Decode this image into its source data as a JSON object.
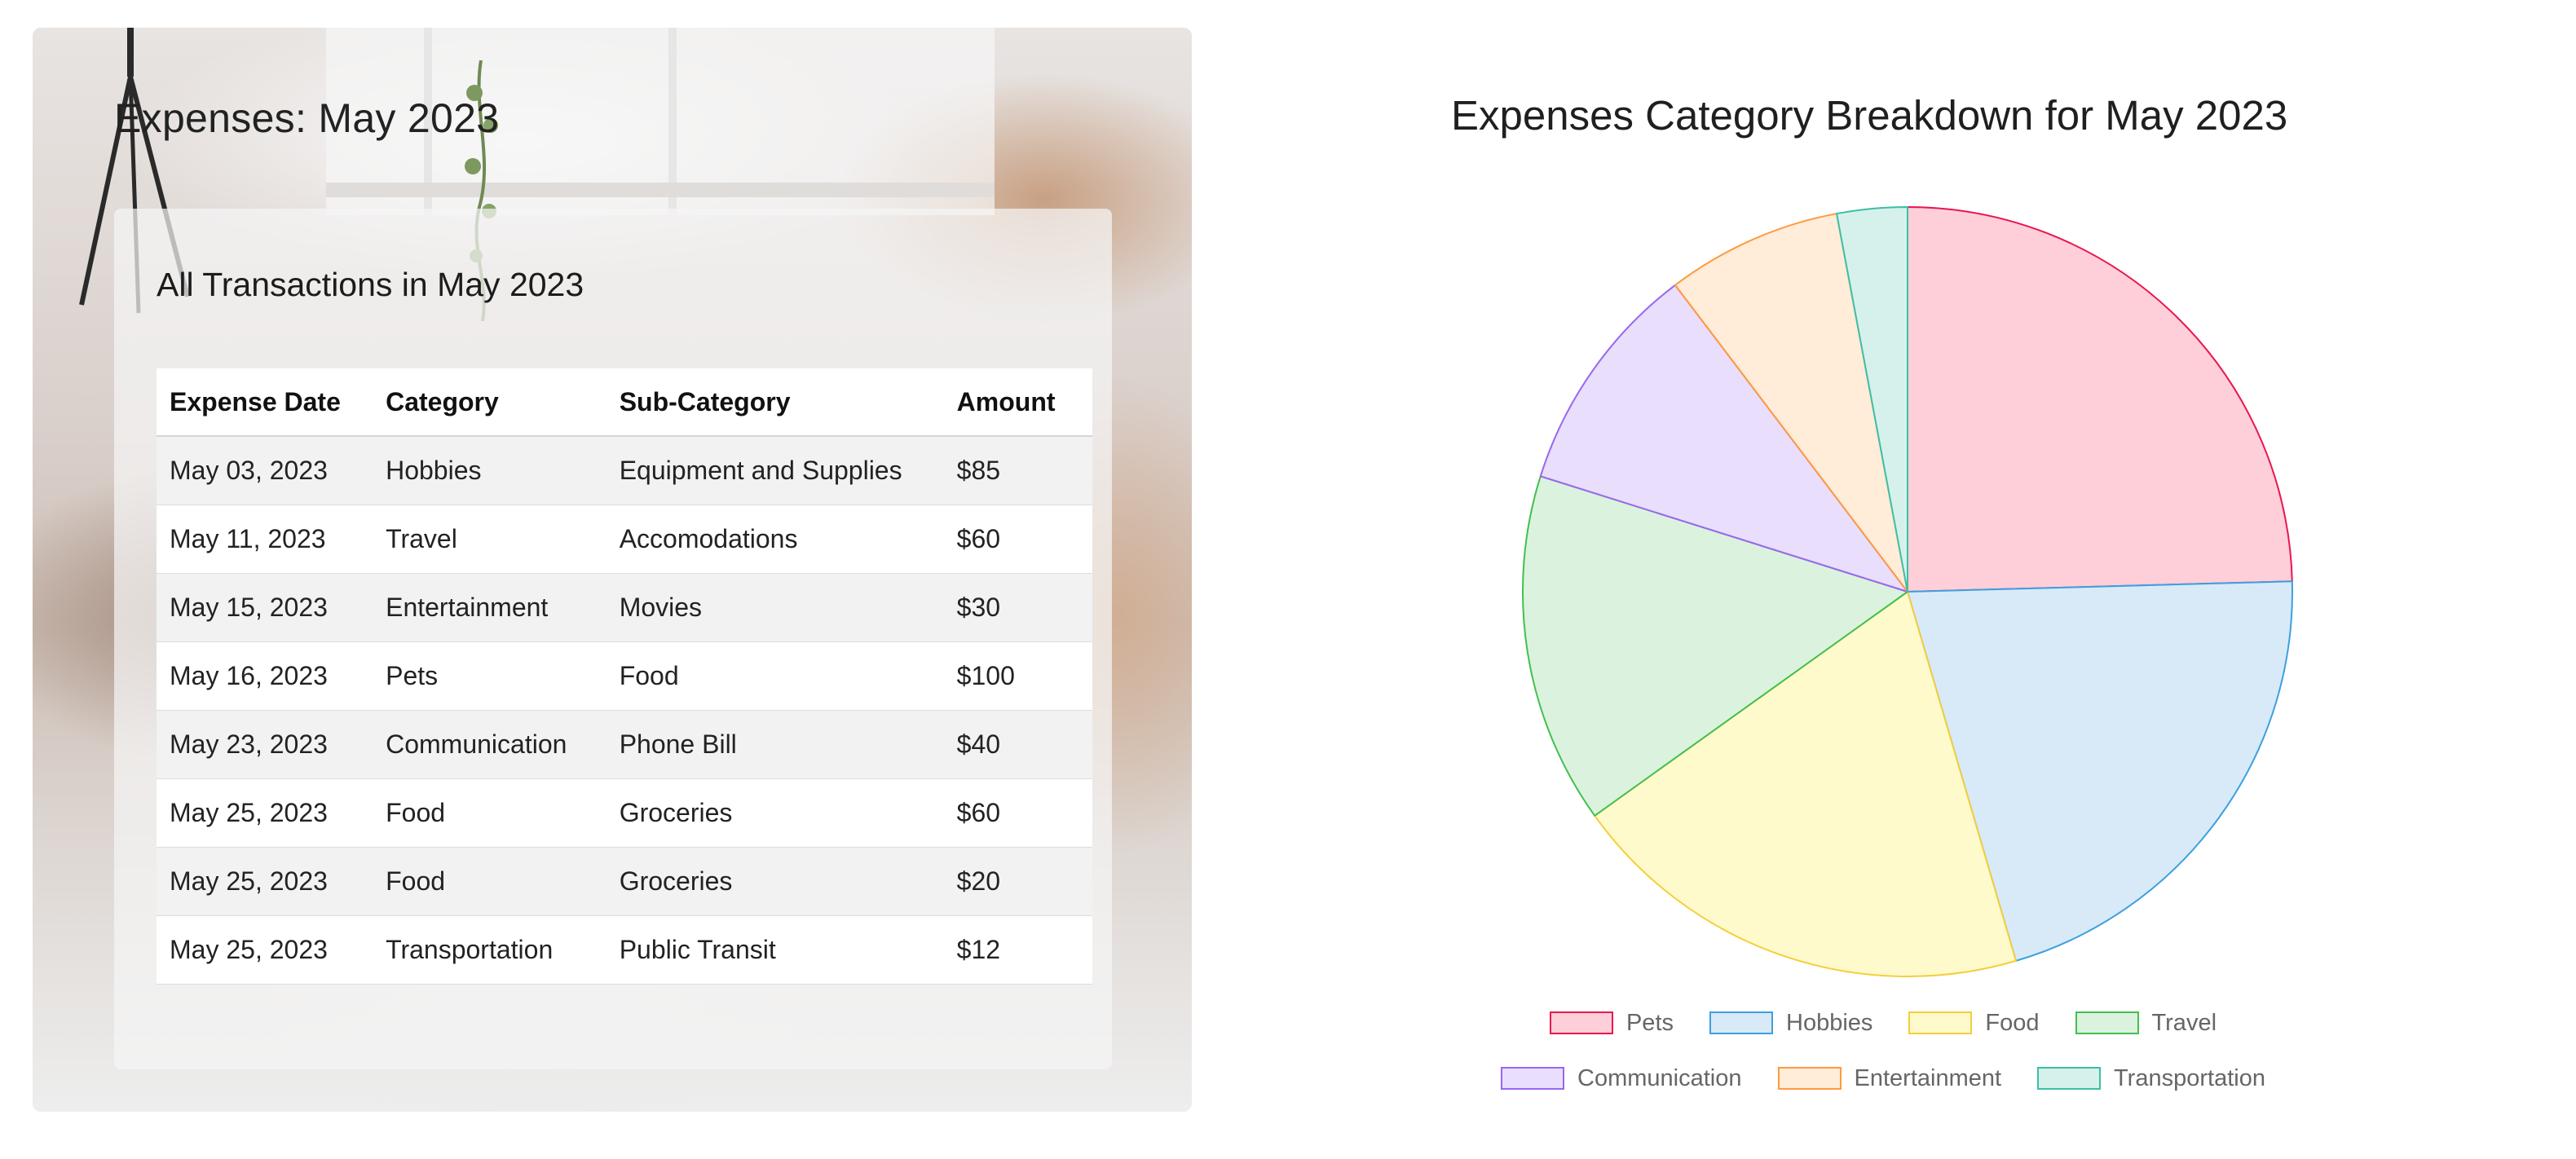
{
  "expenses_card": {
    "title": "Expenses: May 2023",
    "panel_title": "All Transactions in May 2023",
    "columns": [
      "Expense Date",
      "Category",
      "Sub-Category",
      "Amount"
    ],
    "rows": [
      [
        "May 03, 2023",
        "Hobbies",
        "Equipment and Supplies",
        "$85"
      ],
      [
        "May 11, 2023",
        "Travel",
        "Accomodations",
        "$60"
      ],
      [
        "May 15, 2023",
        "Entertainment",
        "Movies",
        "$30"
      ],
      [
        "May 16, 2023",
        "Pets",
        "Food",
        "$100"
      ],
      [
        "May 23, 2023",
        "Communication",
        "Phone Bill",
        "$40"
      ],
      [
        "May 25, 2023",
        "Food",
        "Groceries",
        "$60"
      ],
      [
        "May 25, 2023",
        "Food",
        "Groceries",
        "$20"
      ],
      [
        "May 25, 2023",
        "Transportation",
        "Public Transit",
        "$12"
      ]
    ]
  },
  "chart_data": {
    "type": "pie",
    "title": "Expenses Category Breakdown for May 2023",
    "categories": [
      "Pets",
      "Hobbies",
      "Food",
      "Travel",
      "Communication",
      "Entertainment",
      "Transportation"
    ],
    "values": [
      100,
      85,
      80,
      60,
      40,
      30,
      12
    ],
    "colors": {
      "Pets": {
        "fill": "#ffcfd9",
        "stroke": "#e8174f"
      },
      "Hobbies": {
        "fill": "#d8eaf8",
        "stroke": "#3ca0e0"
      },
      "Food": {
        "fill": "#fffacc",
        "stroke": "#f4ce3c"
      },
      "Travel": {
        "fill": "#dbf3de",
        "stroke": "#43bf4e"
      },
      "Communication": {
        "fill": "#e9defb",
        "stroke": "#9966ee"
      },
      "Entertainment": {
        "fill": "#ffecd9",
        "stroke": "#ff9a3e"
      },
      "Transportation": {
        "fill": "#d6f1ec",
        "stroke": "#3cbfa6"
      }
    },
    "legend_position": "bottom",
    "legend_rows": [
      [
        "Pets",
        "Hobbies",
        "Food",
        "Travel"
      ],
      [
        "Communication",
        "Entertainment",
        "Transportation"
      ]
    ]
  }
}
